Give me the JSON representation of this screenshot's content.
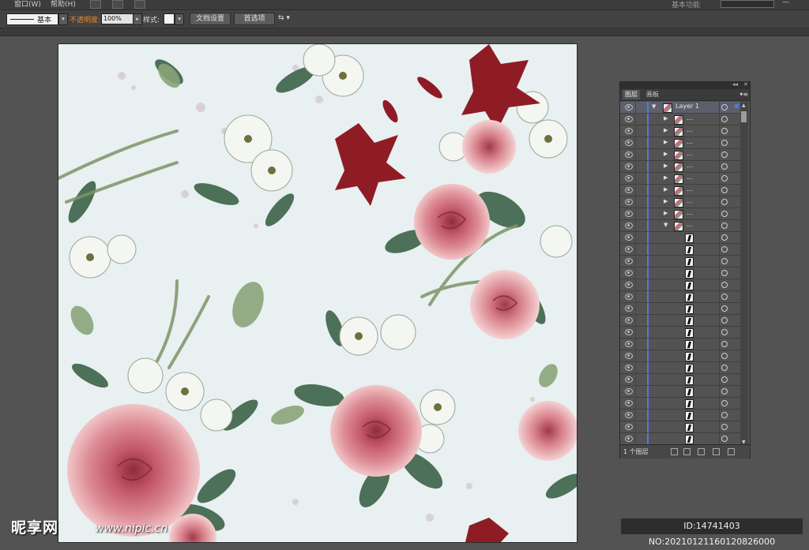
{
  "menubar": {
    "items": [
      "窗口(W)",
      "帮助(H)"
    ],
    "workspace": "基本功能",
    "search_placeholder": ""
  },
  "control_bar": {
    "stroke_profile": "基本",
    "opacity_label": "不透明度:",
    "opacity_value": "100%",
    "style_label": "样式:",
    "document_setup_button": "文档设置",
    "preferences_button": "首选项"
  },
  "layers_panel": {
    "tabs": [
      "图层",
      "画板"
    ],
    "active_tab": "图层",
    "top_layer": "Layer 1",
    "sublayer_label": "...",
    "collapsed_groups": 9,
    "expanded_group_paths": 18,
    "footer_count": "1 个图层"
  },
  "watermark": {
    "logo": "昵享网",
    "url": "www.nipic.cn",
    "id_text": "ID:14741403 NO:20210121160120826000"
  },
  "colors": {
    "app_bg": "#535353",
    "artboard_bg": "#e8f0f1",
    "selection_blue": "#4e7de3",
    "rose_pink": "#c96a78",
    "lily_red": "#8f1c25",
    "leaf_green": "#4d7058"
  }
}
